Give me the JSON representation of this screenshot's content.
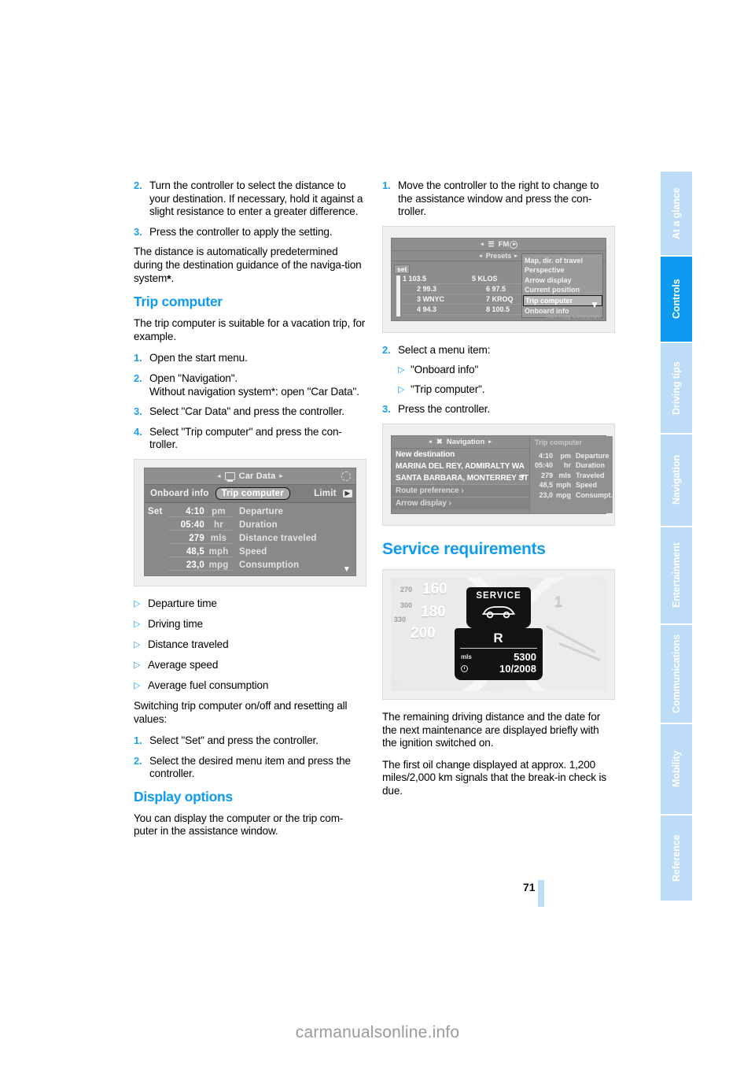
{
  "page": {
    "number": "71",
    "watermark": "carmanualsonline.info"
  },
  "sidebar": {
    "tabs": [
      {
        "label": "At a glance",
        "active": false
      },
      {
        "label": "Controls",
        "active": true
      },
      {
        "label": "Driving tips",
        "active": false
      },
      {
        "label": "Navigation",
        "active": false
      },
      {
        "label": "Entertainment",
        "active": false
      },
      {
        "label": "Communications",
        "active": false
      },
      {
        "label": "Mobility",
        "active": false
      },
      {
        "label": "Reference",
        "active": false
      }
    ]
  },
  "left_column": {
    "step2": {
      "num": "2.",
      "text": "Turn the controller to select the distance to your destination. If necessary, hold it against a slight resistance to enter a greater difference."
    },
    "step3": {
      "num": "3.",
      "text": "Press the controller to apply the setting."
    },
    "para_distance": "The distance is automatically predetermined during the destination guidance of the naviga-tion system",
    "para_distance_star": "*",
    "para_distance_end": ".",
    "heading_trip_computer": "Trip computer",
    "para_trip_intro": "The trip computer is suitable for a vacation trip, for example.",
    "steps": [
      {
        "num": "1.",
        "text": "Open the start menu."
      },
      {
        "num": "2.",
        "text": "Open \"Navigation\".\nWithout navigation system*: open \"Car Data\"."
      },
      {
        "num": "3.",
        "text": "Select \"Car Data\" and press the controller."
      },
      {
        "num": "4.",
        "text": "Select \"Trip computer\" and press the con-troller."
      }
    ],
    "figure_car_data": {
      "code": "VMXXXXXXXX",
      "title": "Car Data",
      "title_icon": "monitor-icon",
      "left_arrow": "◂",
      "right_arrow": "▸",
      "refresh_icon": "refresh-icon",
      "tabs": [
        {
          "label": "Onboard info",
          "selected": false
        },
        {
          "label": "Trip computer",
          "selected": true
        },
        {
          "label": "Limit",
          "selected": false
        }
      ],
      "tab_next_icon": "▶",
      "set_label": "Set",
      "rows": [
        {
          "value": "4:10",
          "unit": "pm",
          "label": "Departure"
        },
        {
          "value": "05:40",
          "unit": "hr",
          "label": "Duration"
        },
        {
          "value": "279",
          "unit": "mls",
          "label": "Distance traveled"
        },
        {
          "value": "48,5",
          "unit": "mph",
          "label": "Speed"
        },
        {
          "value": "23,0",
          "unit": "mpg",
          "label": "Consumption"
        }
      ],
      "scroll_caret": "▼"
    },
    "bullets": [
      "Departure time",
      "Driving time",
      "Distance traveled",
      "Average speed",
      "Average fuel consumption"
    ],
    "bullet_glyph": "▷",
    "para_switching": "Switching trip computer on/off and resetting all values:",
    "steps_switch": [
      {
        "num": "1.",
        "text": "Select \"Set\" and press the controller."
      },
      {
        "num": "2.",
        "text": "Select the desired menu item and press the controller."
      }
    ],
    "heading_display_options": "Display options",
    "para_display_options": "You can display the computer or the trip com-puter in the assistance window."
  },
  "right_column": {
    "step1": {
      "num": "1.",
      "text": "Move the controller to the right to change to the assistance window and press the con-troller."
    },
    "figure_radio": {
      "code": "VMNTBNLRA",
      "title": "FM",
      "title_icon": "radio-icon",
      "presets_label": "Presets",
      "set_label": "set",
      "refresh_icon": "refresh-icon",
      "preset_rows": [
        {
          "left": "1 103.5",
          "right": "5 KLOS"
        },
        {
          "left": "2 99.3",
          "right": "6 97.5"
        },
        {
          "left": "3 WNYC",
          "right": "7 KROQ"
        },
        {
          "left": "4 94.3",
          "right": "8 100.5"
        }
      ],
      "v_marker": "V",
      "menu_items": [
        {
          "label": "Map, dir. of travel",
          "selected": false
        },
        {
          "label": "Perspective",
          "selected": false
        },
        {
          "label": "Arrow display",
          "selected": false
        },
        {
          "label": "Current position",
          "selected": false
        },
        {
          "label": "Trip computer",
          "selected": true
        },
        {
          "label": "Onboard info",
          "selected": false
        }
      ],
      "menu_caret": "▼",
      "ghost_text": "mph  mpg  Consumpt."
    },
    "step2": {
      "num": "2.",
      "text": "Select a menu item:"
    },
    "menu_bullets": [
      "\"Onboard info\"",
      "\"Trip computer\"."
    ],
    "bullet_glyph": "▷",
    "step3": {
      "num": "3.",
      "text": "Press the controller."
    },
    "figure_nav": {
      "code": "VMNTBNLRB",
      "title": "Navigation",
      "title_icon": "crossroads-icon",
      "refresh_icon": "refresh-icon",
      "list": [
        {
          "label": "New destination",
          "dim": false
        },
        {
          "label": "MARINA DEL REY, ADMIRALTY WA",
          "dim": false
        },
        {
          "label": "SANTA BARBARA, MONTERREY ST",
          "dim": false
        },
        {
          "label": "Route preference ›",
          "dim": true
        },
        {
          "label": "Arrow display ›",
          "dim": true
        }
      ],
      "list_caret": "▼",
      "panel_title": "Trip computer",
      "rows": [
        {
          "value": "4:10",
          "unit": "pm",
          "label": "Departure"
        },
        {
          "value": "05:40",
          "unit": "hr",
          "label": "Duration"
        },
        {
          "value": "279",
          "unit": "mls",
          "label": "Traveled"
        },
        {
          "value": "48,5",
          "unit": "mph",
          "label": "Speed"
        },
        {
          "value": "23,0",
          "unit": "mpg",
          "label": "Consumpt."
        }
      ]
    },
    "heading_service": "Service requirements",
    "figure_cluster": {
      "code": "VMZ0990V04",
      "service_label": "SERVICE",
      "car_icon": "car-icon",
      "gear": "R",
      "distance_unit": "mls",
      "distance_value": "5300",
      "date_icon": "clock-icon",
      "date_value": "10/2008",
      "dial_ticks": [
        "160",
        "180",
        "200",
        "270",
        "300",
        "330",
        "1"
      ]
    },
    "para_remaining": "The remaining driving distance and the date for the next maintenance are displayed briefly with the ignition switched on.",
    "para_first_oil": "The first oil change displayed at approx. 1,200 miles/2,000 km signals that the break-in check is due."
  }
}
